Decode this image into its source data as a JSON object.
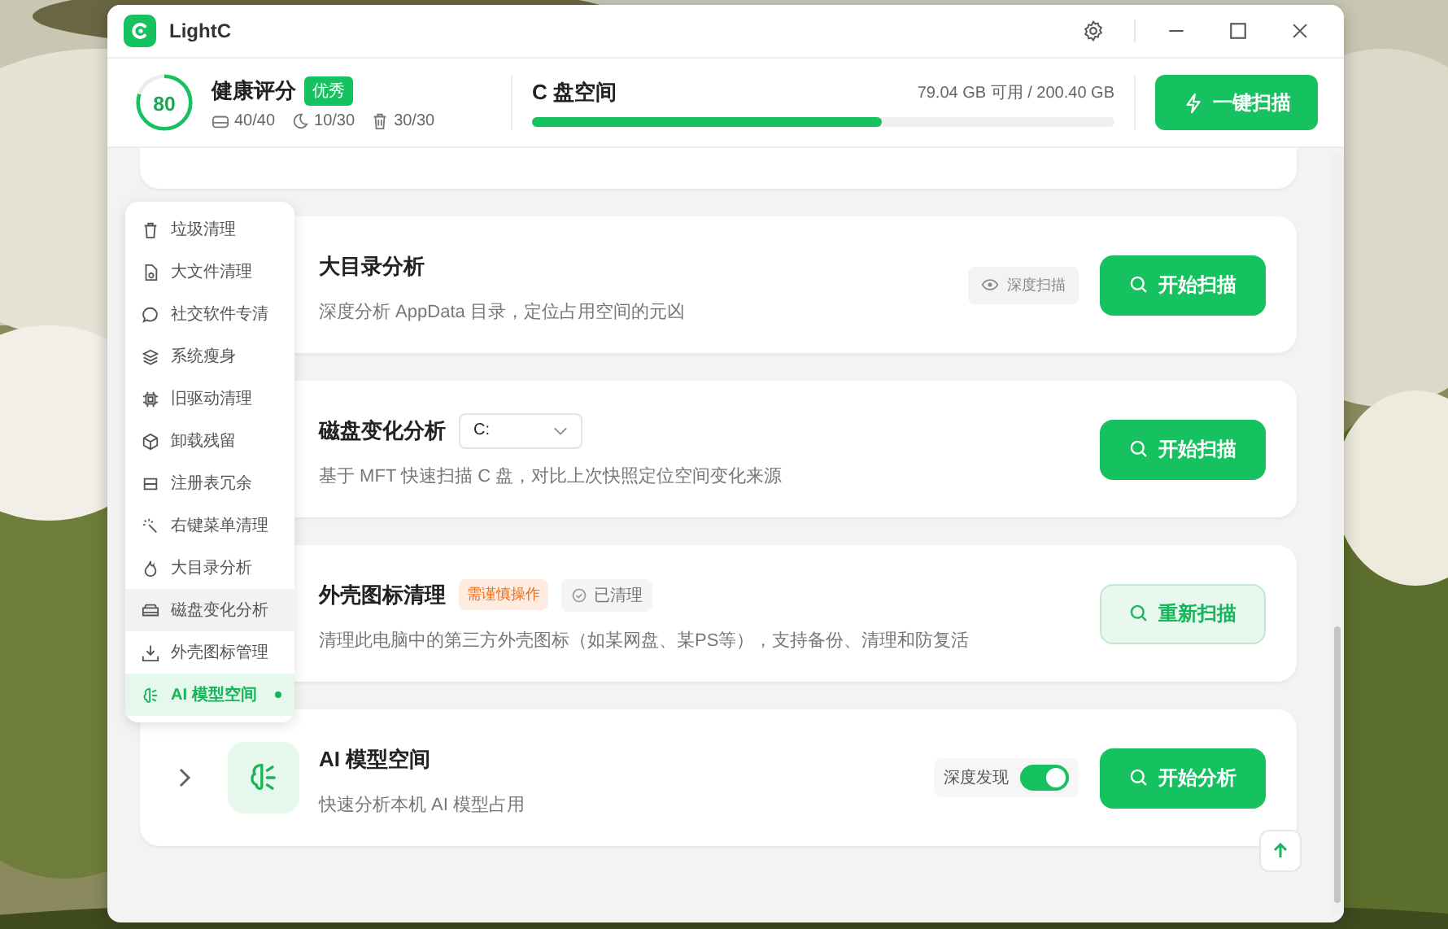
{
  "window": {
    "title": "LightC"
  },
  "health": {
    "label": "健康评分",
    "score": "80",
    "level": 0.8,
    "badge": "优秀",
    "stats": [
      {
        "kind": "disk",
        "text": "40/40"
      },
      {
        "kind": "moon",
        "text": "10/30"
      },
      {
        "kind": "trash",
        "text": "30/30"
      }
    ]
  },
  "disk": {
    "label": "C 盘空间",
    "usage": "79.04 GB 可用 / 200.40 GB",
    "level": 0.6
  },
  "scan_button": "一键扫描",
  "cards": [
    {
      "title": "大目录分析",
      "description": "深度分析 AppData 目录，定位占用空间的元凶",
      "chip": {
        "kind": "eye",
        "text": "深度扫描"
      },
      "button": {
        "kind": "primary",
        "text": "开始扫描"
      }
    },
    {
      "title": "磁盘变化分析",
      "select": "C:",
      "description": "基于 MFT 快速扫描 C 盘，对比上次快照定位空间变化来源",
      "button": {
        "kind": "primary",
        "text": "开始扫描"
      }
    },
    {
      "title": "外壳图标清理",
      "warning": "需谨慎操作",
      "status": "已清理",
      "description": "清理此电脑中的第三方外壳图标（如某网盘、某PS等），支持备份、清理和防复活",
      "button": {
        "kind": "secondary",
        "text": "重新扫描"
      }
    },
    {
      "title": "AI 模型空间",
      "expandable": true,
      "description": "快速分析本机 AI 模型占用",
      "toggle": {
        "label": "深度发现",
        "on": true
      },
      "button": {
        "kind": "primary",
        "text": "开始分析"
      }
    }
  ],
  "menu": [
    {
      "label": "垃圾清理",
      "selected": false,
      "hovered": false
    },
    {
      "label": "大文件清理",
      "selected": false,
      "hovered": false
    },
    {
      "label": "社交软件专清",
      "selected": false,
      "hovered": false
    },
    {
      "label": "系统瘦身",
      "selected": false,
      "hovered": false
    },
    {
      "label": "旧驱动清理",
      "selected": false,
      "hovered": false
    },
    {
      "label": "卸载残留",
      "selected": false,
      "hovered": false
    },
    {
      "label": "注册表冗余",
      "selected": false,
      "hovered": false
    },
    {
      "label": "右键菜单清理",
      "selected": false,
      "hovered": false
    },
    {
      "label": "大目录分析",
      "selected": false,
      "hovered": false
    },
    {
      "label": "磁盘变化分析",
      "selected": false,
      "hovered": true
    },
    {
      "label": "外壳图标管理",
      "selected": false,
      "hovered": false
    },
    {
      "label": "AI 模型空间",
      "selected": true,
      "hovered": false
    }
  ]
}
